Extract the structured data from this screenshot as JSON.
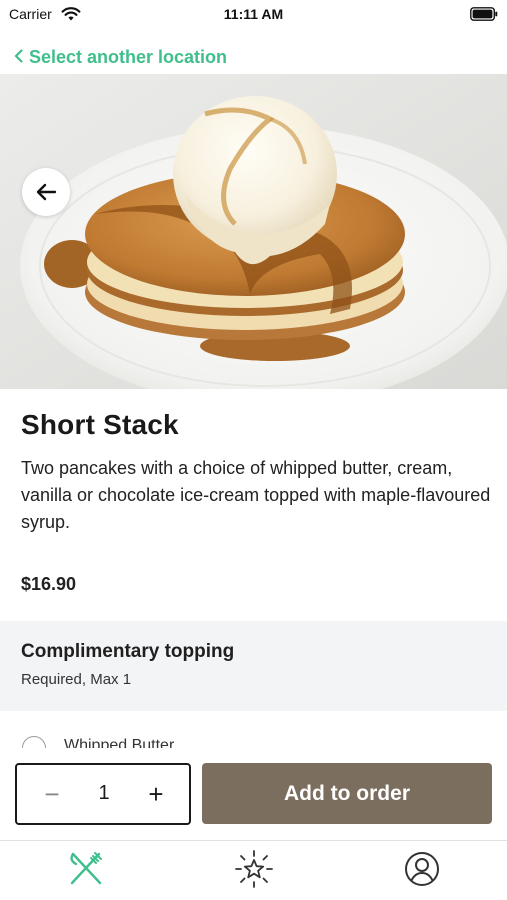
{
  "status_bar": {
    "carrier": "Carrier",
    "time": "11:11 AM",
    "wifi_icon": "wifi-icon",
    "battery_icon": "battery-icon"
  },
  "nav": {
    "back_location_label": "Select another location",
    "back_location_icon": "chevron-left-icon",
    "hero_back_icon": "arrow-left-icon"
  },
  "hero": {
    "image": "pancake-stack-with-ice-cream-photo"
  },
  "product": {
    "title": "Short Stack",
    "description": "Two pancakes with a choice of whipped butter, cream, vanilla or chocolate ice-cream topped with maple-flavoured syrup.",
    "price": "$16.90"
  },
  "topping_group": {
    "title": "Complimentary topping",
    "subtitle": "Required, Max 1",
    "options": [
      {
        "label": "Whipped Butter",
        "selected": false
      }
    ]
  },
  "order_bar": {
    "minus_label": "−",
    "quantity": "1",
    "plus_label": "+",
    "add_label": "Add to order"
  },
  "tab_bar": {
    "tabs": [
      {
        "icon": "fork-knife-icon",
        "active": true
      },
      {
        "icon": "star-burst-icon",
        "active": false
      },
      {
        "icon": "user-profile-icon",
        "active": false
      }
    ]
  },
  "colors": {
    "accent_green": "#3fbf8c",
    "button_brown": "#7b6e5e",
    "band_gray": "#f3f4f6"
  }
}
